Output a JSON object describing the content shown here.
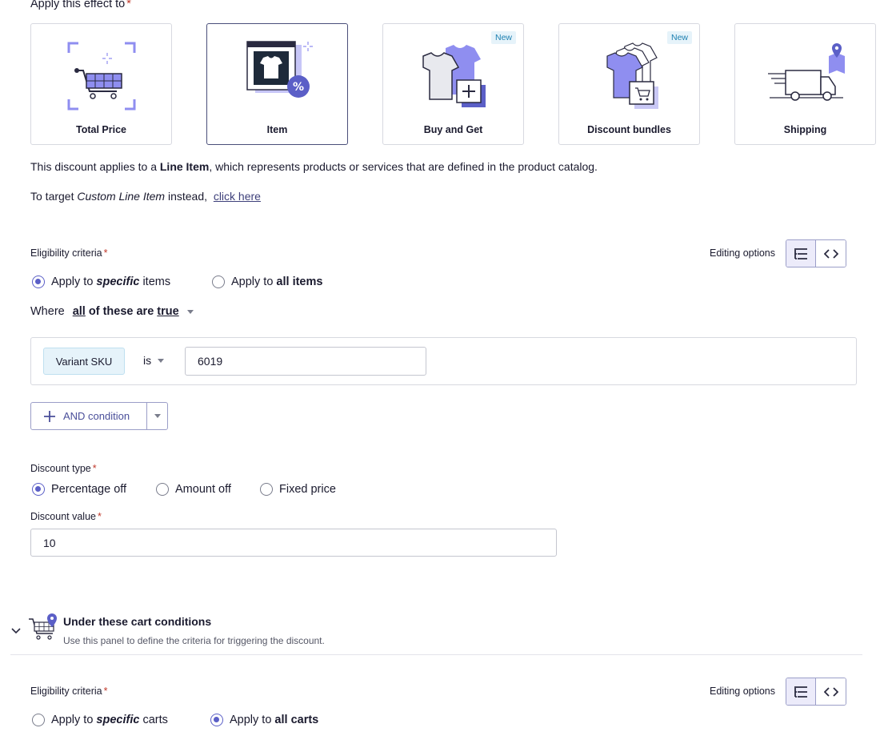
{
  "effect": {
    "heading": "Apply this effect to",
    "cards": [
      {
        "label": "Total Price",
        "badge": "",
        "selected": false
      },
      {
        "label": "Item",
        "badge": "",
        "selected": true
      },
      {
        "label": "Buy and Get",
        "badge": "New",
        "selected": false
      },
      {
        "label": "Discount bundles",
        "badge": "New",
        "selected": false
      },
      {
        "label": "Shipping",
        "badge": "",
        "selected": false
      }
    ],
    "description_prefix": "This discount applies to a ",
    "description_bold": "Line Item",
    "description_suffix": ", which represents products or services that are defined in the product catalog.",
    "target_prefix": "To target ",
    "target_italic": "Custom Line Item",
    "target_suffix": " instead,",
    "target_link": "click here"
  },
  "eligibility": {
    "label": "Eligibility criteria",
    "editing_options_label": "Editing options",
    "radio_specific_prefix": "Apply to ",
    "radio_specific_em": "specific",
    "radio_specific_suffix": " items",
    "radio_all_prefix": "Apply to ",
    "radio_all_bold": "all items",
    "where_label": "Where",
    "where_all": "all",
    "where_mid": " of these are ",
    "where_true": "true",
    "condition": {
      "field": "Variant SKU",
      "operator": "is",
      "value": "6019"
    },
    "and_condition_label": "AND condition"
  },
  "discount_type": {
    "label": "Discount type",
    "options": [
      "Percentage off",
      "Amount off",
      "Fixed price"
    ],
    "selected": "Percentage off"
  },
  "discount_value": {
    "label": "Discount value",
    "value": "10"
  },
  "cart_conditions": {
    "title": "Under these cart conditions",
    "subtitle": "Use this panel to define the criteria for triggering the discount.",
    "eligibility_label": "Eligibility criteria",
    "editing_options_label": "Editing options",
    "radio_specific_prefix": "Apply to ",
    "radio_specific_em": "specific",
    "radio_specific_suffix": " carts",
    "radio_all_prefix": "Apply to ",
    "radio_all_bold": "all carts"
  },
  "colors": {
    "accent": "#5b5fc7",
    "icon_purple": "#8f8ef0",
    "badge_bg": "#e6f3fa",
    "badge_text": "#1c7fb0"
  }
}
